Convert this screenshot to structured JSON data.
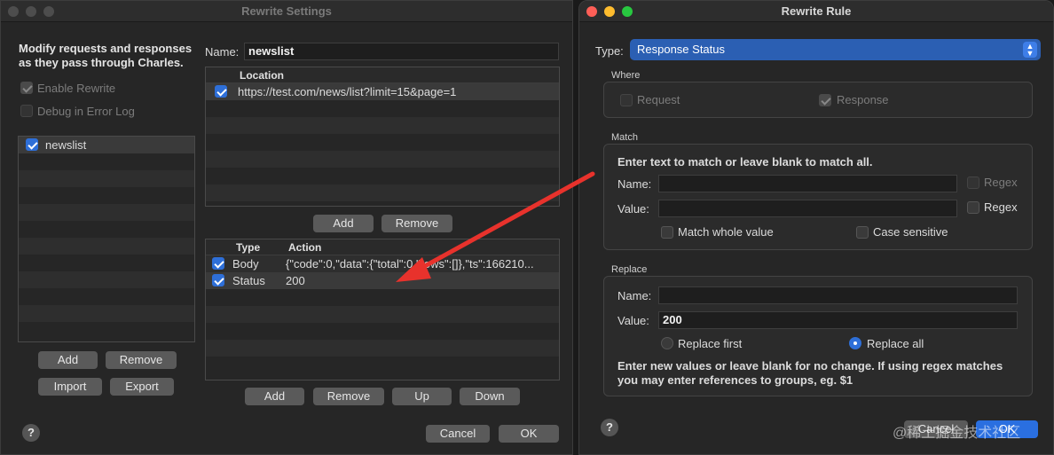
{
  "left_window": {
    "title": "Rewrite Settings",
    "description": "Modify requests and responses as they pass through Charles.",
    "enable_rewrite": "Enable Rewrite",
    "debug_error_log": "Debug in Error Log",
    "sets": [
      "newslist"
    ],
    "sets_add": "Add",
    "sets_remove": "Remove",
    "import": "Import",
    "export": "Export",
    "name_label": "Name:",
    "name_value": "newslist",
    "location_header": "Location",
    "locations": [
      "https://test.com/news/list?limit=15&page=1"
    ],
    "loc_add": "Add",
    "loc_remove": "Remove",
    "rules_col_type": "Type",
    "rules_col_action": "Action",
    "rules": [
      {
        "type": "Body",
        "action": "{\"code\":0,\"data\":{\"total\":0,\"rows\":[]},\"ts\":166210..."
      },
      {
        "type": "Status",
        "action": "200"
      }
    ],
    "rule_add": "Add",
    "rule_remove": "Remove",
    "rule_up": "Up",
    "rule_down": "Down",
    "cancel": "Cancel",
    "ok": "OK",
    "help": "?"
  },
  "right_window": {
    "title": "Rewrite Rule",
    "type_label": "Type:",
    "type_value": "Response Status",
    "where_label": "Where",
    "request": "Request",
    "response": "Response",
    "match_label": "Match",
    "match_hint": "Enter text to match or leave blank to match all.",
    "match_name_label": "Name:",
    "match_value_label": "Value:",
    "regex": "Regex",
    "match_whole_value": "Match whole value",
    "case_sensitive": "Case sensitive",
    "replace_label": "Replace",
    "replace_name_label": "Name:",
    "replace_value_label": "Value:",
    "replace_value": "200",
    "replace_first": "Replace first",
    "replace_all": "Replace all",
    "replace_hint": "Enter new values or leave blank for no change. If using regex matches you may enter references to groups, eg. $1",
    "cancel": "Cancel",
    "ok": "OK",
    "help": "?"
  },
  "watermark": "@稀土掘金技术社区",
  "colors": {
    "accent": "#2e6fd8",
    "arrow": "#e8322c"
  }
}
